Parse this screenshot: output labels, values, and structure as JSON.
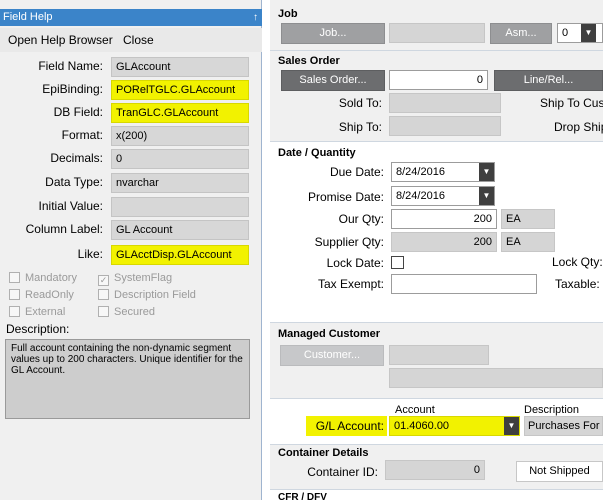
{
  "help": {
    "title": "Field Help",
    "pin_icon": "↑",
    "menu": {
      "open_browser": "Open Help Browser",
      "close": "Close"
    },
    "fields": [
      {
        "label": "Field Name:",
        "value": "GLAccount",
        "highlight": false
      },
      {
        "label": "EpiBinding:",
        "value": "PORelTGLC.GLAccount",
        "highlight": true
      },
      {
        "label": "DB Field:",
        "value": "TranGLC.GLAccount",
        "highlight": true
      },
      {
        "label": "Format:",
        "value": "x(200)",
        "highlight": false
      },
      {
        "label": "Decimals:",
        "value": "0",
        "highlight": false
      },
      {
        "label": "Data Type:",
        "value": "nvarchar",
        "highlight": false
      },
      {
        "label": "Initial Value:",
        "value": "",
        "highlight": false
      },
      {
        "label": "Column Label:",
        "value": "GL Account",
        "highlight": false
      },
      {
        "label": "Like:",
        "value": "GLAcctDisp.GLAccount",
        "highlight": true
      }
    ],
    "flags": {
      "mandatory": "Mandatory",
      "system_flag": "SystemFlag",
      "read_only": "ReadOnly",
      "description_field": "Description Field",
      "external": "External",
      "secured": "Secured",
      "check_mark": "✓"
    },
    "description_label": "Description:",
    "description": "Full account containing the non-dynamic segment values up to 200 characters.  Unique identifier for the GL Account."
  },
  "form": {
    "job": {
      "title": "Job",
      "job_button": "Job...",
      "asm_button": "Asm...",
      "asm_value": "0"
    },
    "sales_order": {
      "title": "Sales Order",
      "sales_order_button": "Sales Order...",
      "order_value": "0",
      "line_rel_button": "Line/Rel...",
      "sold_to_label": "Sold To:",
      "ship_to_label": "Ship To:",
      "ship_to_cust_label": "Ship To Cus",
      "drop_ship_label": "Drop Ship"
    },
    "date_quantity": {
      "title": "Date / Quantity",
      "due_date_label": "Due Date:",
      "due_date": "8/24/2016",
      "promise_date_label": "Promise Date:",
      "promise_date": "8/24/2016",
      "our_qty_label": "Our Qty:",
      "our_qty": "200",
      "our_uom": "EA",
      "supplier_qty_label": "Supplier Qty:",
      "supplier_qty": "200",
      "supplier_uom": "EA",
      "lock_date_label": "Lock Date:",
      "lock_qty_label": "Lock Qty:",
      "tax_exempt_label": "Tax Exempt:",
      "taxable_label": "Taxable:"
    },
    "managed_customer": {
      "title": "Managed Customer",
      "customer_button": "Customer..."
    },
    "gl": {
      "account_header": "Account",
      "description_header": "Description",
      "gl_account_label": "G/L Account:",
      "gl_account": "01.4060.00",
      "description": "Purchases For J"
    },
    "container": {
      "title": "Container Details",
      "container_id_label": "Container ID:",
      "container_id": "0",
      "status_button": "Not Shipped"
    },
    "next_section_title": "CFR / DFV"
  }
}
